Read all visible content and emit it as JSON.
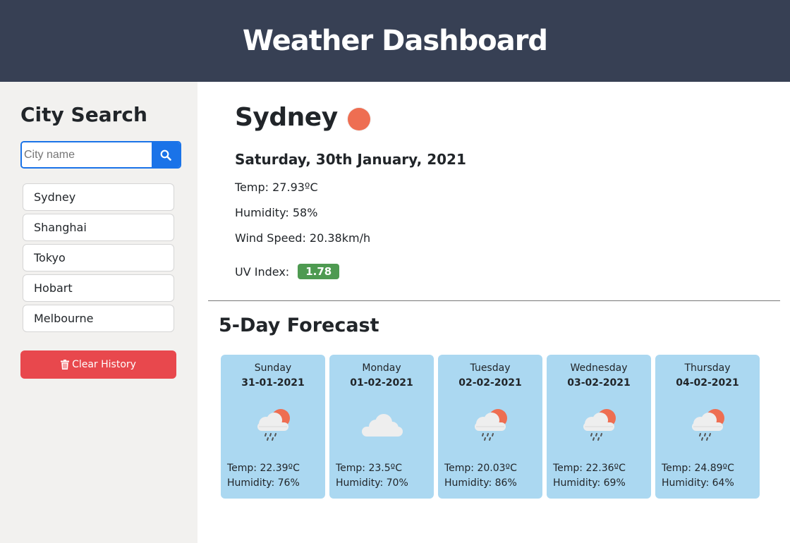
{
  "header": {
    "title": "Weather Dashboard"
  },
  "sidebar": {
    "title": "City Search",
    "search_placeholder": "City name",
    "search_value": "",
    "history": [
      {
        "label": "Sydney"
      },
      {
        "label": "Shanghai"
      },
      {
        "label": "Tokyo"
      },
      {
        "label": "Hobart"
      },
      {
        "label": "Melbourne"
      }
    ],
    "clear_label": "Clear History"
  },
  "current": {
    "city": "Sydney",
    "date": "Saturday, 30th January, 2021",
    "temp": "Temp: 27.93ºC",
    "humidity": "Humidity: 58%",
    "wind": "Wind Speed: 20.38km/h",
    "uv_label": "UV Index:",
    "uv_value": "1.78",
    "uv_color": "#4e9a51",
    "icon": "sun-icon"
  },
  "forecast": {
    "title": "5-Day Forecast",
    "days": [
      {
        "day": "Sunday",
        "date": "31-01-2021",
        "icon": "rain-sun-icon",
        "temp": "Temp: 22.39ºC",
        "humidity": "Humidity: 76%"
      },
      {
        "day": "Monday",
        "date": "01-02-2021",
        "icon": "cloud-icon",
        "temp": "Temp: 23.5ºC",
        "humidity": "Humidity: 70%"
      },
      {
        "day": "Tuesday",
        "date": "02-02-2021",
        "icon": "rain-sun-icon",
        "temp": "Temp: 20.03ºC",
        "humidity": "Humidity: 86%"
      },
      {
        "day": "Wednesday",
        "date": "03-02-2021",
        "icon": "rain-sun-icon",
        "temp": "Temp: 22.36ºC",
        "humidity": "Humidity: 69%"
      },
      {
        "day": "Thursday",
        "date": "04-02-2021",
        "icon": "rain-sun-icon",
        "temp": "Temp: 24.89ºC",
        "humidity": "Humidity: 64%"
      }
    ]
  },
  "colors": {
    "header_bg": "#374054",
    "accent": "#1a73e8",
    "danger": "#e8484d",
    "card_bg": "#abd8f1",
    "sun": "#ee6e52"
  }
}
